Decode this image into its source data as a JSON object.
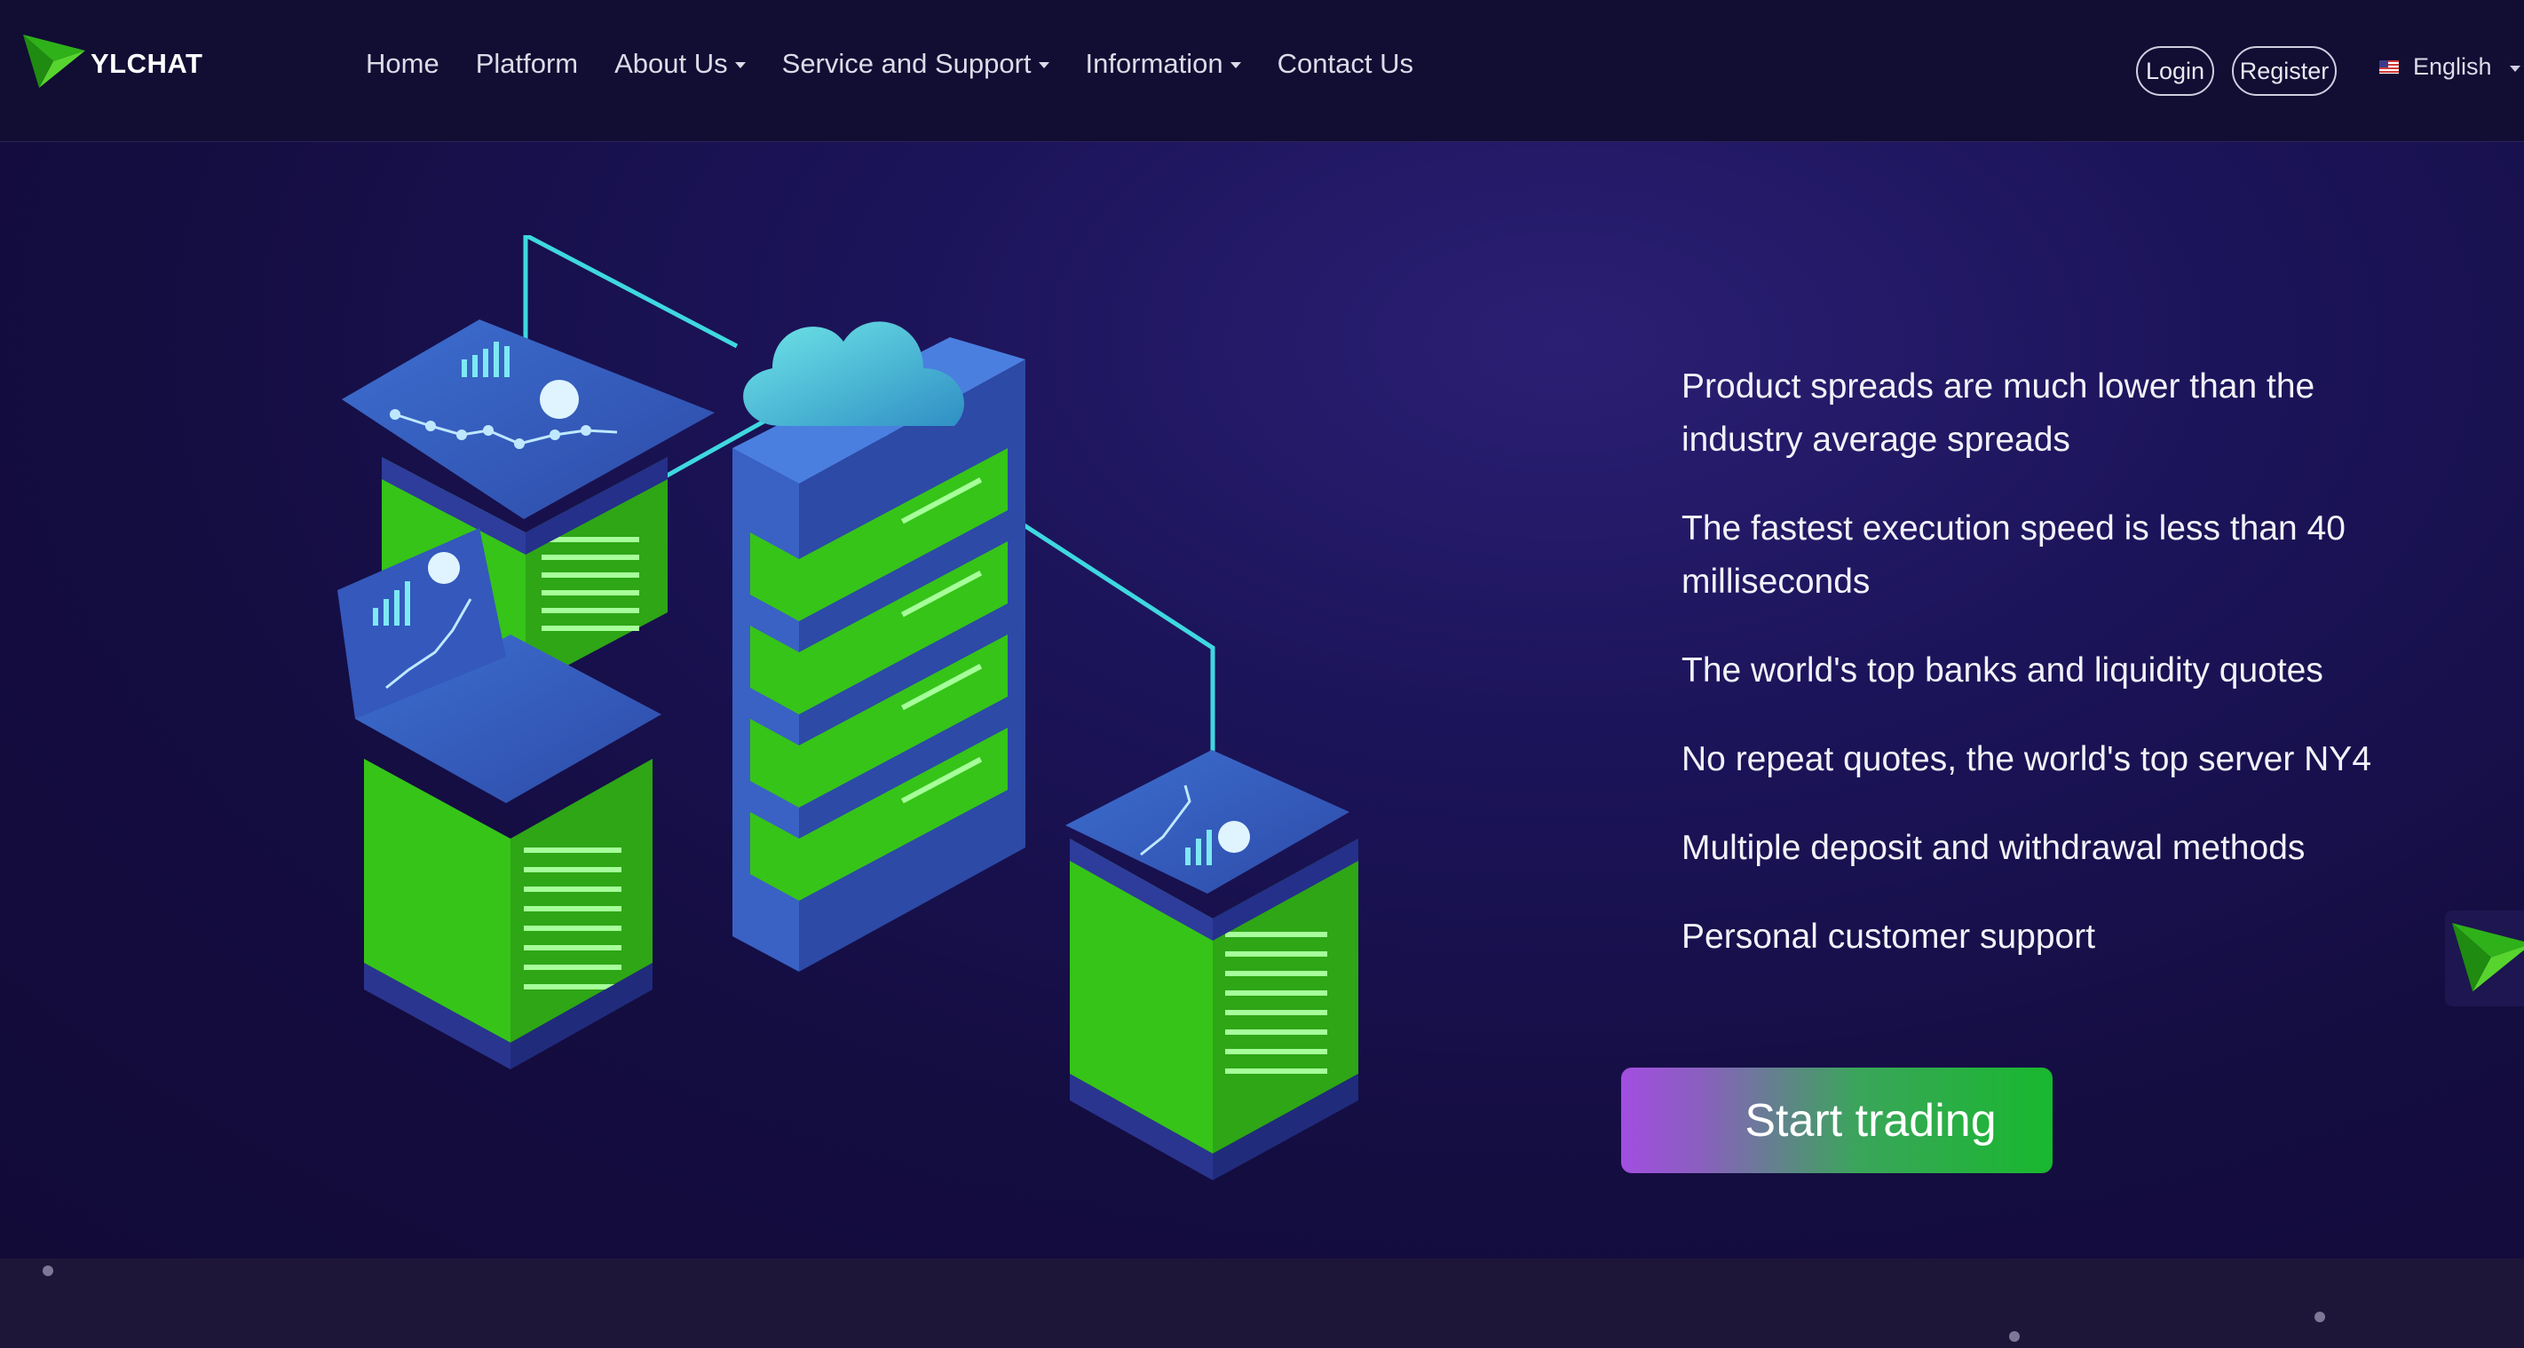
{
  "brand": {
    "name": "YLCHAT",
    "icon": "ylchat-logo-icon",
    "accent": "#36c418"
  },
  "nav": {
    "items": [
      {
        "label": "Home",
        "dropdown": false
      },
      {
        "label": "Platform",
        "dropdown": false
      },
      {
        "label": "About Us",
        "dropdown": true
      },
      {
        "label": "Service and Support",
        "dropdown": true
      },
      {
        "label": "Information",
        "dropdown": true
      },
      {
        "label": "Contact Us",
        "dropdown": false
      }
    ],
    "login_label": "Login",
    "register_label": "Register",
    "language": {
      "label": "English",
      "icon": "us-flag-icon"
    }
  },
  "hero": {
    "features": [
      "Product spreads are much lower than the industry average spreads",
      "The fastest execution speed is less than 40 milliseconds",
      "The world's top banks and liquidity quotes",
      "No repeat quotes, the world's top server NY4",
      "Multiple deposit and withdrawal methods",
      "Personal customer support"
    ],
    "cta_label": "Start trading",
    "cta_gradient": [
      "#a24ee0",
      "#18b82e"
    ]
  },
  "colors": {
    "background": "#120c38",
    "nav_background": "#110d33",
    "server_green": "#36c418",
    "server_blue": "#3a61c4",
    "cyan_line": "#3fd8e0"
  }
}
